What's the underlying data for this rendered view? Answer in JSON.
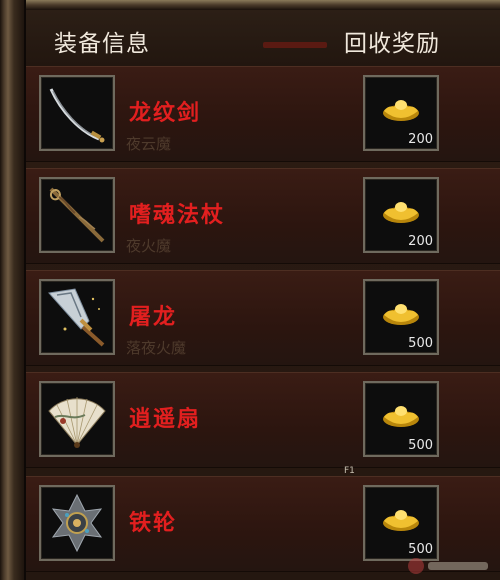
{
  "header": {
    "equip_info": "装备信息",
    "recycle_reward": "回收奖励"
  },
  "items": [
    {
      "name": "龙纹剑",
      "ghost_text": "夜云魔",
      "reward": "200",
      "icon": "saber-icon"
    },
    {
      "name": "嗜魂法杖",
      "ghost_text": "夜火魔",
      "reward": "200",
      "icon": "staff-icon"
    },
    {
      "name": "屠龙",
      "ghost_text": "落夜火魔",
      "reward": "500",
      "icon": "dragon-slayer-blade-icon"
    },
    {
      "name": "逍遥扇",
      "ghost_text": "",
      "reward": "500",
      "icon": "fan-icon"
    },
    {
      "name": "铁轮",
      "ghost_text": "",
      "reward": "500",
      "icon": "iron-wheel-icon"
    }
  ],
  "reward_icon": "gold-ingot-icon",
  "hotkey_label": "F1",
  "colors": {
    "item_name": "#e21f1f",
    "header_text": "#f0e8dc",
    "ingot_gold": "#e0b020"
  }
}
